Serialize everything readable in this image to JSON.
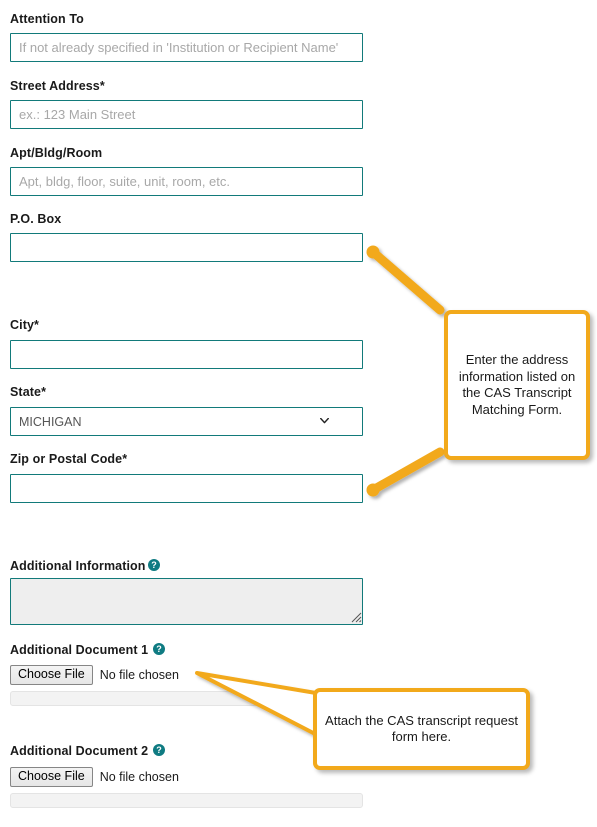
{
  "form": {
    "fields": [
      {
        "id": "attention-to",
        "label": "Attention To",
        "type": "text",
        "value": "",
        "placeholder": "If not already specified in 'Institution or Recipient Name'"
      },
      {
        "id": "street-address",
        "label": "Street Address*",
        "type": "text",
        "value": "",
        "placeholder": "ex.: 123 Main Street"
      },
      {
        "id": "apt-bldg-room",
        "label": "Apt/Bldg/Room",
        "type": "text",
        "value": "",
        "placeholder": "Apt, bldg, floor, suite, unit, room, etc."
      },
      {
        "id": "po-box",
        "label": "P.O. Box",
        "type": "text",
        "value": "",
        "placeholder": ""
      },
      {
        "id": "city",
        "label": "City*",
        "type": "text",
        "value": "",
        "placeholder": ""
      },
      {
        "id": "state",
        "label": "State*",
        "type": "select",
        "value": "MICHIGAN",
        "options": [
          "MICHIGAN"
        ]
      },
      {
        "id": "zip-postal-code",
        "label": "Zip or Postal Code*",
        "type": "text",
        "value": "",
        "placeholder": ""
      },
      {
        "id": "additional-information",
        "label": "Additional Information",
        "type": "textarea",
        "value": "",
        "has_help": true,
        "help_glyph": "?"
      },
      {
        "id": "additional-document-1",
        "label": "Additional Document 1",
        "type": "file",
        "has_help": true,
        "help_glyph": "?",
        "button_label": "Choose File",
        "file_status": "No file chosen"
      },
      {
        "id": "additional-document-2",
        "label": "Additional Document 2",
        "type": "file",
        "has_help": true,
        "help_glyph": "?",
        "button_label": "Choose File",
        "file_status": "No file chosen"
      }
    ]
  },
  "callouts": [
    {
      "id": "address-callout",
      "text": "Enter the address information listed on the CAS Transcript Matching Form."
    },
    {
      "id": "attach-callout",
      "text": "Attach the CAS transcript request form here."
    }
  ],
  "colors": {
    "input_border": "#127a7a",
    "callout_border": "#f2a91b",
    "help_icon": "#0f7b82",
    "label_text": "#1a1a1a",
    "placeholder_text": "#a8a8a8",
    "textarea_fill": "#eeeeee",
    "progress_fill": "#f3f3f3"
  }
}
